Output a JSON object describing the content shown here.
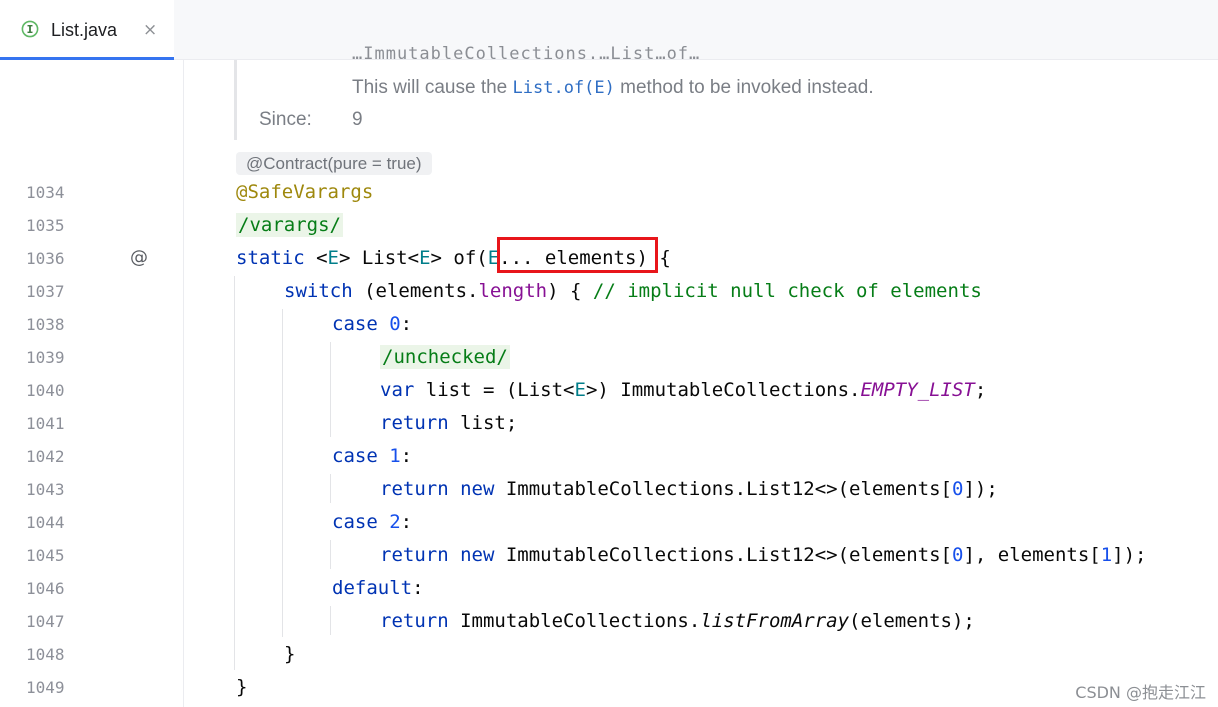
{
  "tab": {
    "label": "List.java",
    "close_glyph": "×",
    "icon": "interface-icon",
    "accent": "#3574f0"
  },
  "gutter": {
    "line_numbers": [
      "1034",
      "1035",
      "1036",
      "1037",
      "1038",
      "1039",
      "1040",
      "1041",
      "1042",
      "1043",
      "1044",
      "1045",
      "1046",
      "1047",
      "1048",
      "1049"
    ],
    "marker": "@"
  },
  "doc": {
    "cut_line": "…ImmutableCollections.…List…of…",
    "text_before": "This will cause the ",
    "code": "List.of(E)",
    "text_after": " method to be invoked instead.",
    "since_label": "Since:",
    "since_value": "9",
    "contract": "@Contract(pure = true)"
  },
  "code": {
    "annotation": "@SafeVarargs",
    "varargs_badge": "/varargs/",
    "static": "static",
    "lt": " <",
    "type_e": "E",
    "list_open": "> List<",
    "of_open": "> of(",
    "elements_param": "... elements",
    "sig_close": ") {",
    "switch": "switch",
    "switch_open": " (elements.",
    "length": "length",
    "switch_close": ") { ",
    "switch_comment": "// implicit null check of elements",
    "case": "case",
    "zero": "0",
    "one": "1",
    "two": "2",
    "colon": ":",
    "unchecked_badge": "/unchecked/",
    "var": "var",
    "var_list": " list = (List<",
    "var_cast": ">) ImmutableCollections.",
    "empty_list": "EMPTY_LIST",
    "semicolon": ";",
    "return": "return",
    "return_list": " list;",
    "new": "new",
    "list12": " ImmutableCollections.List12<>(elements[",
    "close_bracket": "]);",
    "mid_bracket": "], elements[",
    "default": "default",
    "return_ic": " ImmutableCollections.",
    "list_from_array": "listFromArray",
    "lfa_args": "(elements);",
    "brace": "}"
  },
  "watermark": "CSDN @抱走江江"
}
